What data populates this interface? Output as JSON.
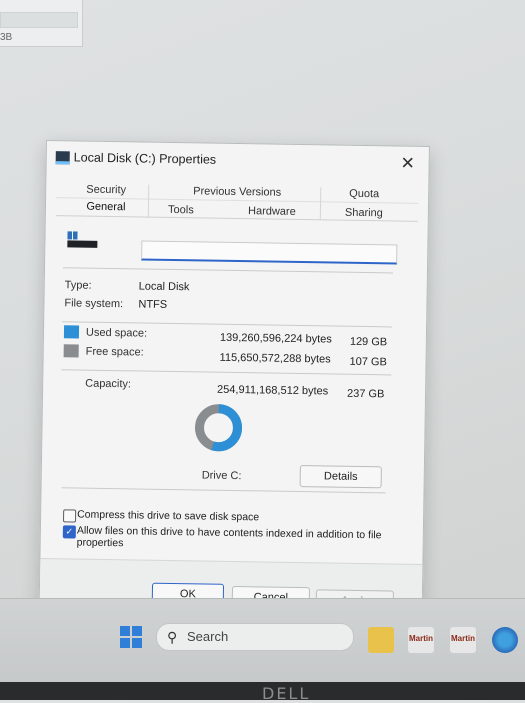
{
  "background_window": {
    "partial_text": "3B"
  },
  "dialog": {
    "title": "Local Disk (C:) Properties",
    "close_glyph": "✕",
    "tabs_top_row": [
      "Security",
      "Previous Versions",
      "Quota"
    ],
    "tabs_bottom_row": [
      "General",
      "Tools",
      "Hardware",
      "Sharing"
    ],
    "active_tab": "General",
    "name_input_value": "",
    "type_label": "Type:",
    "type_value": "Local Disk",
    "fs_label": "File system:",
    "fs_value": "NTFS",
    "used_label": "Used space:",
    "used_bytes": "139,260,596,224 bytes",
    "used_gb": "129 GB",
    "free_label": "Free space:",
    "free_bytes": "115,650,572,288 bytes",
    "free_gb": "107 GB",
    "capacity_label": "Capacity:",
    "capacity_bytes": "254,911,168,512 bytes",
    "capacity_gb": "237 GB",
    "used_fraction": 0.546,
    "drive_label": "Drive C:",
    "details_button": "Details",
    "compress_label": "Compress this drive to save disk space",
    "compress_checked": false,
    "index_label_line1": "Allow files on this drive to have contents indexed in addition to file",
    "index_label_line2": "properties",
    "index_checked": true,
    "ok_button": "OK",
    "cancel_button": "Cancel",
    "apply_button": "Apply"
  },
  "colors": {
    "used_space": "#2d8fd6",
    "free_space": "#8a8d90",
    "accent": "#2f65c9"
  },
  "taskbar": {
    "search_placeholder": "Search",
    "start_icon": "windows-start-icon",
    "search_icon": "search-icon",
    "apps": [
      "file-explorer-icon",
      "martin-app-icon",
      "martin-app-icon",
      "edge-icon"
    ],
    "app_text_1": "Martin",
    "app_text_2": "Martin"
  }
}
